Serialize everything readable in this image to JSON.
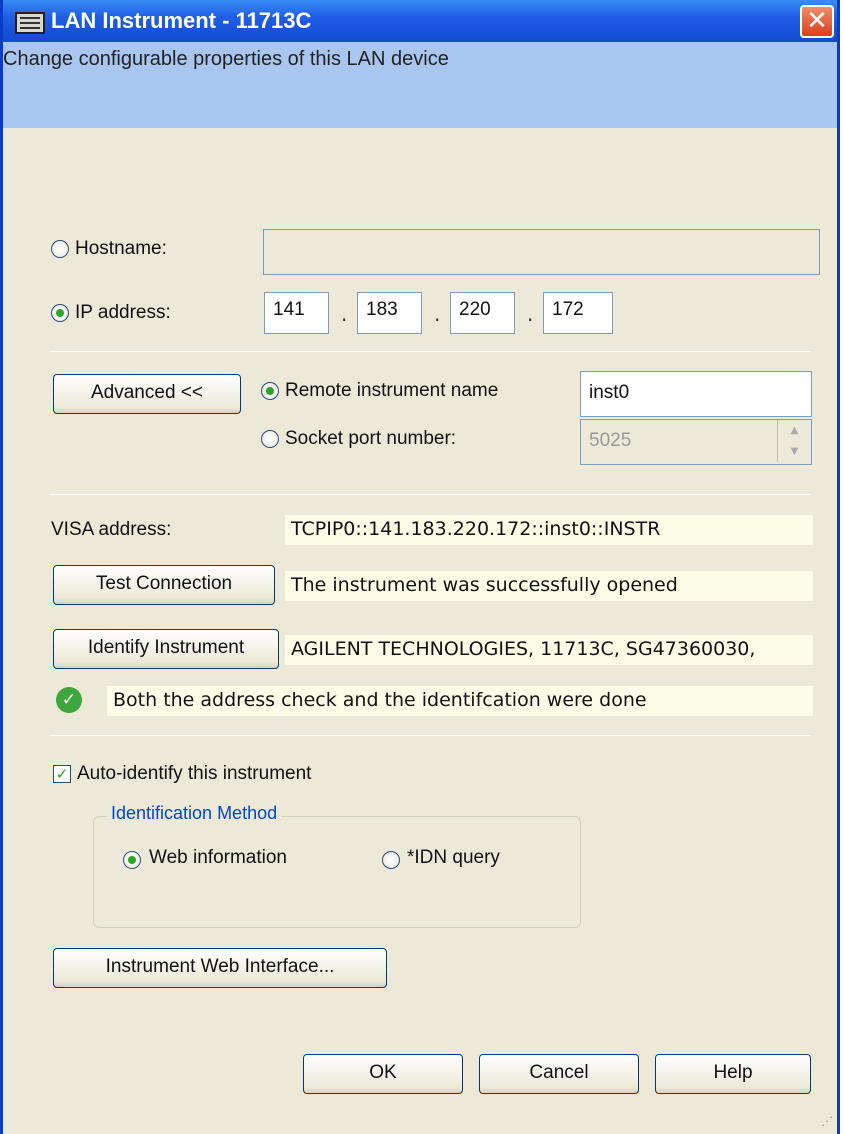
{
  "window": {
    "title": "LAN Instrument - 11713C",
    "close_glyph": "✕",
    "banner": "Change configurable properties of this LAN device"
  },
  "address": {
    "hostname_label": "Hostname:",
    "hostname_value": "",
    "ip_label": "IP address:",
    "ip_octets": [
      "141",
      "183",
      "220",
      "172"
    ],
    "selected": "ip",
    "separator": "."
  },
  "advanced": {
    "button_label": "Advanced <<",
    "remote_name_label": "Remote instrument name",
    "remote_name_value": "inst0",
    "socket_label": "Socket port number:",
    "socket_value": "5025",
    "selected": "remote_name"
  },
  "connection": {
    "visa_label": "VISA address:",
    "visa_value": "TCPIP0::141.183.220.172::inst0::INSTR",
    "test_button": "Test Connection",
    "test_result": "The instrument was successfully opened",
    "identify_button": "Identify Instrument",
    "identify_result": "AGILENT TECHNOLOGIES, 11713C, SG47360030,",
    "status_icon": "check-circle-icon",
    "status_text": "Both the address check and the identifcation were done"
  },
  "auto_identify": {
    "label": "Auto-identify this instrument",
    "checked": true,
    "group_title": "Identification Method",
    "web_label": "Web information",
    "idn_label": "*IDN query",
    "selected": "web"
  },
  "web_interface_button": "Instrument Web Interface...",
  "footer": {
    "ok": "OK",
    "cancel": "Cancel",
    "help": "Help"
  },
  "colors": {
    "titlebar": "#1f5ee6",
    "banner": "#a9c6f0",
    "dialog_bg": "#ece9d8",
    "result_bg": "#fdfce6",
    "radio_selected": "#2aa52a"
  }
}
